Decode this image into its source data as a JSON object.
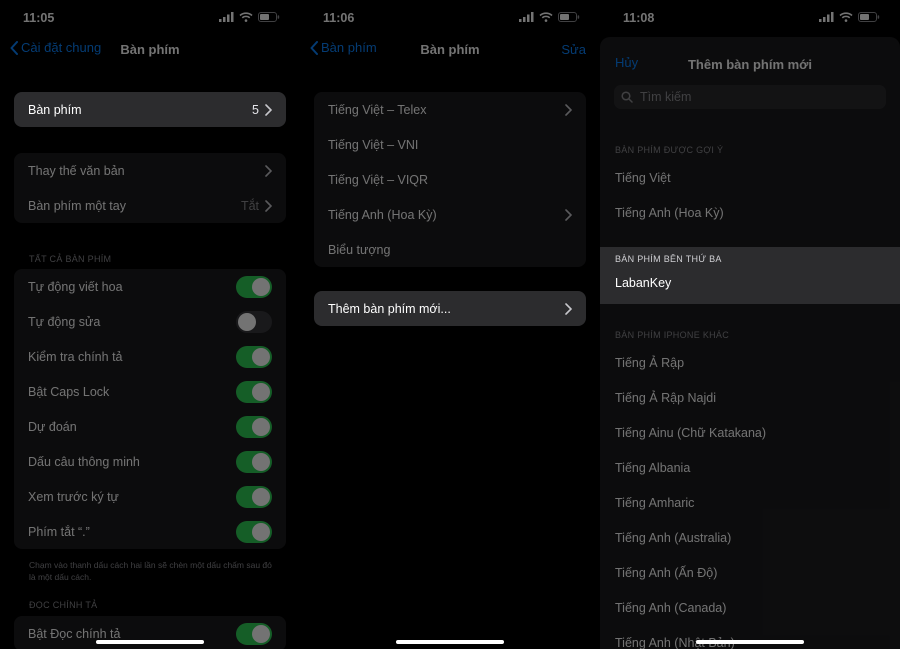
{
  "colors": {
    "accent": "#0a84ff",
    "toggle_on": "#30d158",
    "cell": "#1c1c1e"
  },
  "panel1": {
    "time": "11:05",
    "back_label": "Cài đặt chung",
    "title": "Bàn phím",
    "keyboards_row": {
      "label": "Bàn phím",
      "value": "5"
    },
    "group2": [
      {
        "label": "Thay thế văn bản",
        "value": ""
      },
      {
        "label": "Bàn phím một tay",
        "value": "Tắt"
      }
    ],
    "all_keyboards_header": "TẤT CẢ BÀN PHÍM",
    "toggles": [
      {
        "label": "Tự động viết hoa",
        "on": true
      },
      {
        "label": "Tự động sửa",
        "on": false
      },
      {
        "label": "Kiểm tra chính tả",
        "on": true
      },
      {
        "label": "Bật Caps Lock",
        "on": true
      },
      {
        "label": "Dự đoán",
        "on": true
      },
      {
        "label": "Dấu câu thông minh",
        "on": true
      },
      {
        "label": "Xem trước ký tự",
        "on": true
      },
      {
        "label": "Phím tắt “.”",
        "on": true
      }
    ],
    "footer_note": "Chạm vào thanh dấu cách hai lần sẽ chèn một dấu chấm sau đó là một dấu cách.",
    "dictation_header": "ĐỌC CHÍNH TẢ",
    "dictation_row": {
      "label": "Bật Đọc chính tả",
      "on": true
    }
  },
  "panel2": {
    "time": "11:06",
    "back_label": "Bàn phím",
    "title": "Bàn phím",
    "edit_label": "Sửa",
    "keyboards": [
      {
        "label": "Tiếng Việt – Telex",
        "chevron": true
      },
      {
        "label": "Tiếng Việt – VNI",
        "chevron": false
      },
      {
        "label": "Tiếng Việt – VIQR",
        "chevron": false
      },
      {
        "label": "Tiếng Anh (Hoa Kỳ)",
        "chevron": true
      },
      {
        "label": "Biểu tượng",
        "chevron": false
      }
    ],
    "add_label": "Thêm bàn phím mới..."
  },
  "panel3": {
    "time": "11:08",
    "cancel_label": "Hủy",
    "title": "Thêm bàn phím mới",
    "search_placeholder": "Tìm kiếm",
    "suggested_header": "BÀN PHÍM ĐƯỢC GỢI Ý",
    "suggested": [
      "Tiếng Việt",
      "Tiếng Anh (Hoa Kỳ)"
    ],
    "third_party_header": "BÀN PHÍM BÊN THỨ BA",
    "third_party": [
      "LabanKey"
    ],
    "other_header": "BÀN PHÍM IPHONE KHÁC",
    "other": [
      "Tiếng Ả Rập",
      "Tiếng Ả Rập Najdi",
      "Tiếng Ainu (Chữ Katakana)",
      "Tiếng Albania",
      "Tiếng Amharic",
      "Tiếng Anh (Australia)",
      "Tiếng Anh (Ấn Độ)",
      "Tiếng Anh (Canada)",
      "Tiếng Anh (Nhật Bản)"
    ]
  }
}
